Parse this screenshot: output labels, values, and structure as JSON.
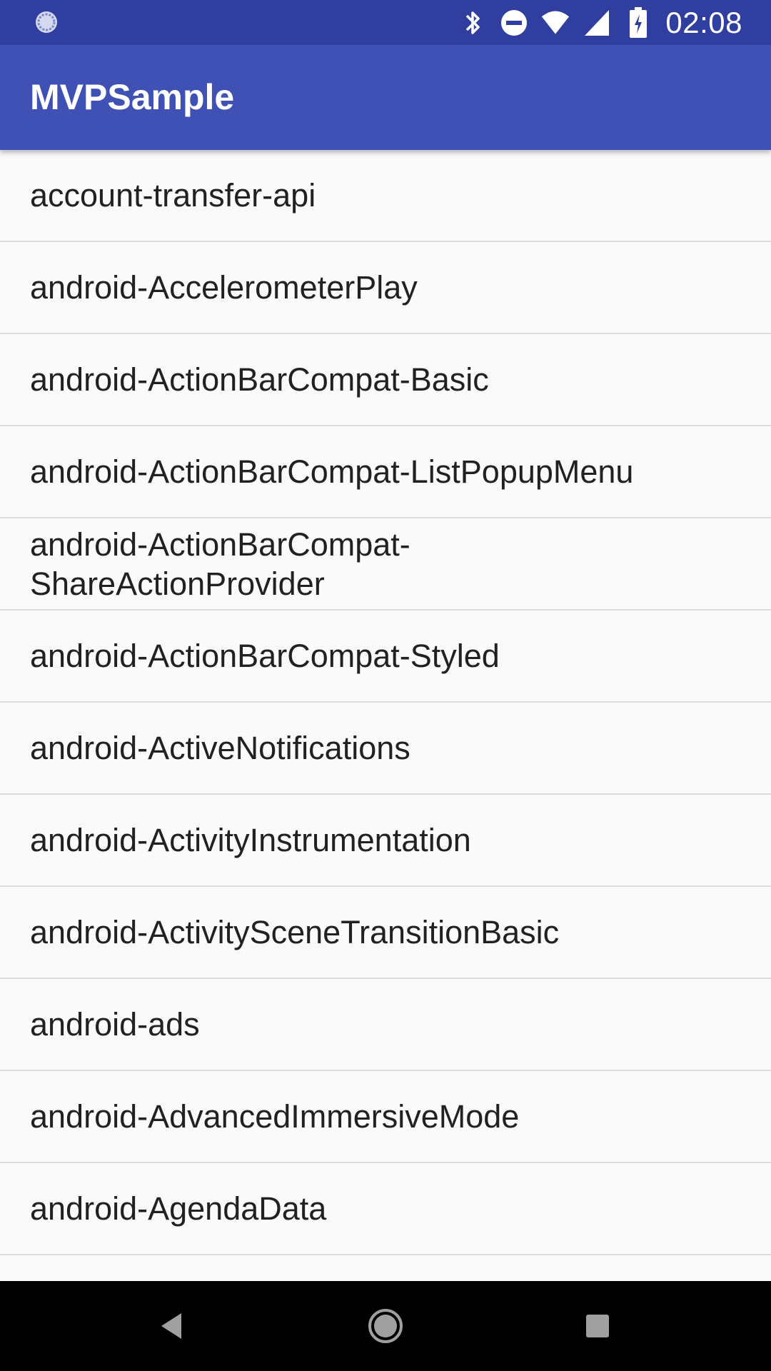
{
  "status_bar": {
    "time": "02:08",
    "icons": [
      "sync-icon",
      "bluetooth-icon",
      "do-not-disturb-icon",
      "wifi-icon",
      "cell-signal-icon",
      "battery-charging-icon"
    ]
  },
  "app_bar": {
    "title": "MVPSample"
  },
  "list": {
    "items": [
      {
        "label": "account-transfer-api"
      },
      {
        "label": "android-AccelerometerPlay"
      },
      {
        "label": "android-ActionBarCompat-Basic"
      },
      {
        "label": "android-ActionBarCompat-ListPopupMenu"
      },
      {
        "label": "android-ActionBarCompat-\nShareActionProvider"
      },
      {
        "label": "android-ActionBarCompat-Styled"
      },
      {
        "label": "android-ActiveNotifications"
      },
      {
        "label": "android-ActivityInstrumentation"
      },
      {
        "label": "android-ActivitySceneTransitionBasic"
      },
      {
        "label": "android-ads"
      },
      {
        "label": "android-AdvancedImmersiveMode"
      },
      {
        "label": "android-AgendaData"
      },
      {
        "label": ""
      }
    ]
  },
  "nav_bar": {
    "icons": [
      "back-icon",
      "home-icon",
      "recents-icon"
    ]
  },
  "colors": {
    "status_bar": "#303f9f",
    "app_bar": "#3f51b5",
    "list_background": "#fafafa",
    "divider": "#dcdcdc",
    "nav_bar": "#000000"
  }
}
